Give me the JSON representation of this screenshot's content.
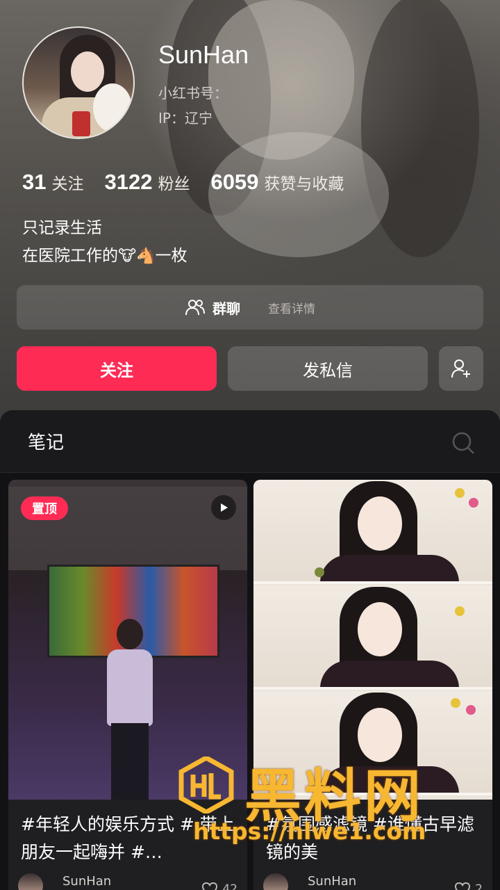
{
  "profile": {
    "username": "SunHan",
    "red_id_label": "小红书号：",
    "ip_label": "IP：辽宁",
    "stats": [
      {
        "num": "31",
        "label": "关注"
      },
      {
        "num": "3122",
        "label": "粉丝"
      },
      {
        "num": "6059",
        "label": "获赞与收藏"
      }
    ],
    "bio_line1": "只记录生活",
    "bio_line2_prefix": "在医院工作的",
    "bio_emoji_cow": "🐮",
    "bio_emoji_horse": "🐴",
    "bio_line2_suffix": "一枚"
  },
  "group": {
    "title": "群聊",
    "detail": "查看详情",
    "icon": "group-users-icon"
  },
  "actions": {
    "follow_label": "关注",
    "message_label": "发私信",
    "add_friend_icon": "add-user-icon"
  },
  "notes": {
    "tab_label": "笔记",
    "search_icon": "search-icon"
  },
  "cards": [
    {
      "pin_label": "置顶",
      "title": "#年轻人的娱乐方式 # 带上朋友一起嗨并 #…",
      "author": "SunHan",
      "likes": "42"
    },
    {
      "title": "#氛围感滤镜 #谁懂古早滤镜的美",
      "author": "SunHan",
      "likes": "2"
    }
  ],
  "watermark": {
    "text": "黑料网",
    "url": "https://hlwe1.com"
  },
  "colors": {
    "accent": "#fe2c55",
    "watermark": "#f7b731",
    "panel_bg": "#121214"
  }
}
